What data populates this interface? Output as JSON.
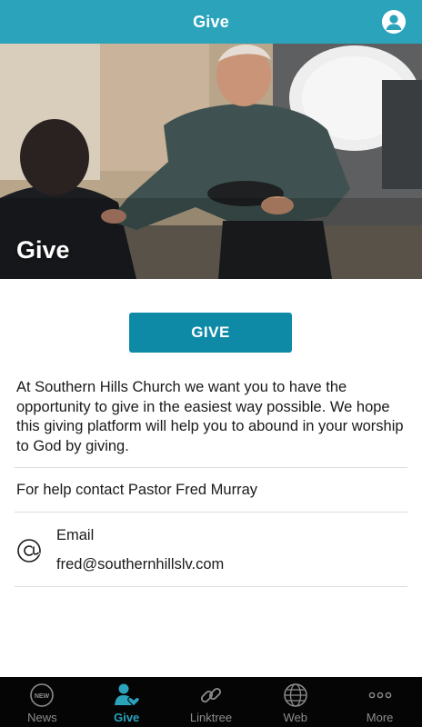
{
  "header": {
    "title": "Give",
    "profile_icon": "user-circle-icon"
  },
  "hero": {
    "title": "Give"
  },
  "give_button": {
    "label": "GIVE"
  },
  "content": {
    "description": "At Southern Hills Church we want you to have the opportunity to give in the easiest way possible.  We hope this giving platform will help you to abound in your worship to God by giving.",
    "help_text": "For help contact Pastor Fred Murray",
    "email": {
      "label": "Email",
      "value": "fred@southernhillslv.com",
      "icon": "at-sign-icon"
    }
  },
  "tabbar": {
    "items": [
      {
        "label": "News",
        "icon": "news-badge-icon",
        "active": false
      },
      {
        "label": "Give",
        "icon": "give-person-heart-icon",
        "active": true
      },
      {
        "label": "Linktree",
        "icon": "link-icon",
        "active": false
      },
      {
        "label": "Web",
        "icon": "globe-icon",
        "active": false
      },
      {
        "label": "More",
        "icon": "more-dots-icon",
        "active": false
      }
    ]
  },
  "colors": {
    "accent": "#2aa3bb",
    "button": "#0e8aa6",
    "tabbar_bg": "#050505",
    "inactive": "#8d8d8d"
  }
}
